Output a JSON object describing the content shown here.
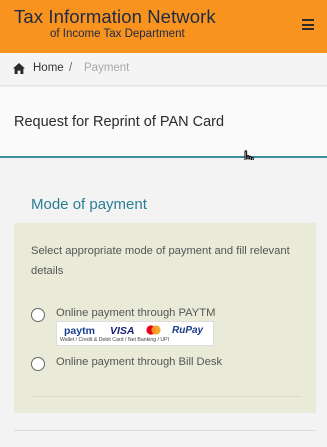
{
  "header": {
    "brand_line1": "Tax Information Network",
    "brand_line2": "of Income Tax Department",
    "menu_icon": "hamburger-menu-icon",
    "color": "#f7931e"
  },
  "breadcrumb": {
    "home_icon": "home-icon",
    "home_label": "Home",
    "separator": "/",
    "current": "Payment"
  },
  "page": {
    "title": "Request for Reprint of PAN Card"
  },
  "payment": {
    "heading": "Mode of payment",
    "instruction": "Select appropriate mode of payment and fill relevant details",
    "options": [
      {
        "label": "Online payment through PAYTM",
        "logos": {
          "paytm": "paytm",
          "visa": "VISA",
          "rupay": "RuPay",
          "caption": "Wallet / Credit & Debit Card / Net Banking / UPI"
        }
      },
      {
        "label": "Online payment through Bill Desk"
      }
    ]
  },
  "accent_color": "#2a7e93"
}
